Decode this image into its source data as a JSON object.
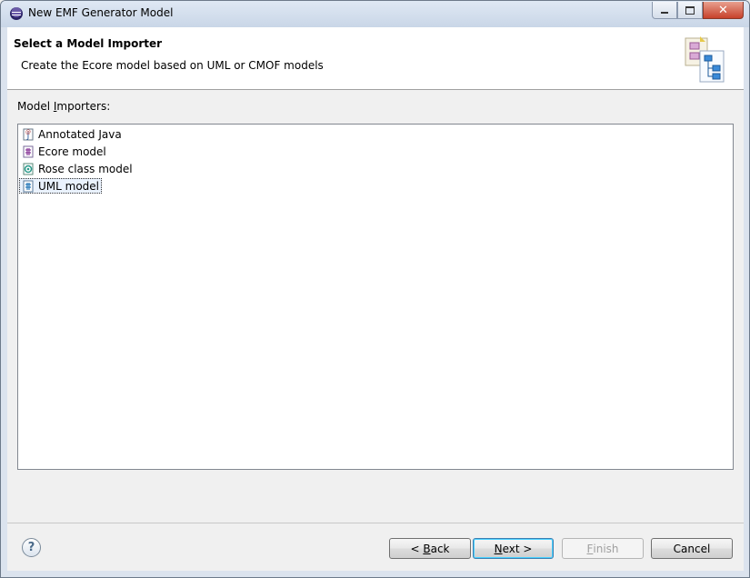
{
  "window": {
    "title": "New EMF Generator Model"
  },
  "header": {
    "title": "Select a Model Importer",
    "description": "Create the Ecore model based on UML or CMOF models"
  },
  "importers": {
    "label_pre": "Model ",
    "label_mnemonic": "I",
    "label_post": "mporters:",
    "items": [
      {
        "label": "Annotated Java",
        "icon": "java-annotation-icon"
      },
      {
        "label": "Ecore model",
        "icon": "ecore-model-icon"
      },
      {
        "label": "Rose class model",
        "icon": "rose-model-icon"
      },
      {
        "label": "UML model",
        "icon": "uml-model-icon",
        "selected": true
      }
    ]
  },
  "buttons": {
    "help": "?",
    "back_pre": "< ",
    "back_mnemonic": "B",
    "back_post": "ack",
    "next_mnemonic": "N",
    "next_post": "ext >",
    "finish_mnemonic": "F",
    "finish_post": "inish",
    "cancel": "Cancel"
  },
  "colors": {
    "selection_bg": "#eaf2fd",
    "default_button_border": "#3c7fb1"
  }
}
